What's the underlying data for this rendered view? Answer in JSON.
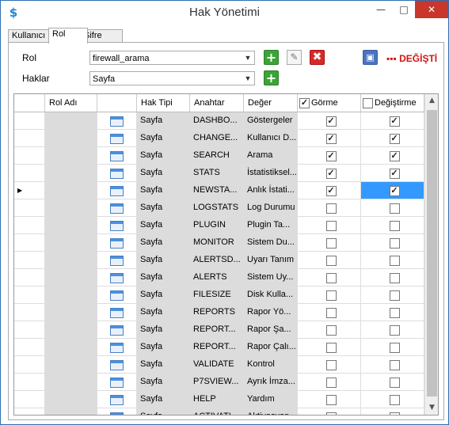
{
  "window": {
    "title": "Hak Yönetimi",
    "app_icon": "app-logo-icon"
  },
  "tabs": [
    {
      "label": "Kullanıcı"
    },
    {
      "label": "Rol"
    },
    {
      "label": "Şifre Politikası"
    }
  ],
  "form": {
    "rol_label": "Rol",
    "rol_value": "firewall_arama",
    "haklar_label": "Haklar",
    "haklar_value": "Sayfa",
    "changed_text": "DEĞİŞTİ",
    "changed_dots": "▪▪▪"
  },
  "grid": {
    "columns": [
      "",
      "Rol Adı",
      "",
      "Hak Tipi",
      "Anahtar",
      "Değer",
      "Görme",
      "Değiştirme"
    ],
    "header_gorme_checked": true,
    "header_degistirme_checked": false,
    "rows": [
      {
        "rol": "",
        "tip": "Sayfa",
        "anahtar": "DASHBO...",
        "deger": "Göstergeler",
        "gorme": true,
        "degistirme": true,
        "current": false
      },
      {
        "rol": "",
        "tip": "Sayfa",
        "anahtar": "CHANGE...",
        "deger": "Kullanıcı D...",
        "gorme": true,
        "degistirme": true,
        "current": false
      },
      {
        "rol": "",
        "tip": "Sayfa",
        "anahtar": "SEARCH",
        "deger": "Arama",
        "gorme": true,
        "degistirme": true,
        "current": false
      },
      {
        "rol": "",
        "tip": "Sayfa",
        "anahtar": "STATS",
        "deger": "İstatistiksel...",
        "gorme": true,
        "degistirme": true,
        "current": false
      },
      {
        "rol": "",
        "tip": "Sayfa",
        "anahtar": "NEWSTA...",
        "deger": "Anlık İstati...",
        "gorme": true,
        "degistirme": true,
        "current": true
      },
      {
        "rol": "",
        "tip": "Sayfa",
        "anahtar": "LOGSTATS",
        "deger": "Log Durumu",
        "gorme": false,
        "degistirme": false,
        "current": false
      },
      {
        "rol": "",
        "tip": "Sayfa",
        "anahtar": "PLUGIN",
        "deger": "Plugin Ta...",
        "gorme": false,
        "degistirme": false,
        "current": false
      },
      {
        "rol": "",
        "tip": "Sayfa",
        "anahtar": "MONITOR",
        "deger": "Sistem Du...",
        "gorme": false,
        "degistirme": false,
        "current": false
      },
      {
        "rol": "",
        "tip": "Sayfa",
        "anahtar": "ALERTSD...",
        "deger": "Uyarı Tanım",
        "gorme": false,
        "degistirme": false,
        "current": false
      },
      {
        "rol": "",
        "tip": "Sayfa",
        "anahtar": "ALERTS",
        "deger": "Sistem Uy...",
        "gorme": false,
        "degistirme": false,
        "current": false
      },
      {
        "rol": "",
        "tip": "Sayfa",
        "anahtar": "FILESIZE",
        "deger": "Disk Kulla...",
        "gorme": false,
        "degistirme": false,
        "current": false
      },
      {
        "rol": "",
        "tip": "Sayfa",
        "anahtar": "REPORTS",
        "deger": "Rapor Yö...",
        "gorme": false,
        "degistirme": false,
        "current": false
      },
      {
        "rol": "",
        "tip": "Sayfa",
        "anahtar": "REPORT...",
        "deger": "Rapor Şa...",
        "gorme": false,
        "degistirme": false,
        "current": false
      },
      {
        "rol": "",
        "tip": "Sayfa",
        "anahtar": "REPORT...",
        "deger": "Rapor Çalı...",
        "gorme": false,
        "degistirme": false,
        "current": false
      },
      {
        "rol": "",
        "tip": "Sayfa",
        "anahtar": "VALIDATE",
        "deger": "Kontrol",
        "gorme": false,
        "degistirme": false,
        "current": false
      },
      {
        "rol": "",
        "tip": "Sayfa",
        "anahtar": "P7SVIEW...",
        "deger": "Ayrık İmza...",
        "gorme": false,
        "degistirme": false,
        "current": false
      },
      {
        "rol": "",
        "tip": "Sayfa",
        "anahtar": "HELP",
        "deger": "Yardım",
        "gorme": false,
        "degistirme": false,
        "current": false
      },
      {
        "rol": "",
        "tip": "Sayfa",
        "anahtar": "ACTIVATI...",
        "deger": "Aktivasyon",
        "gorme": false,
        "degistirme": false,
        "current": false
      }
    ]
  }
}
